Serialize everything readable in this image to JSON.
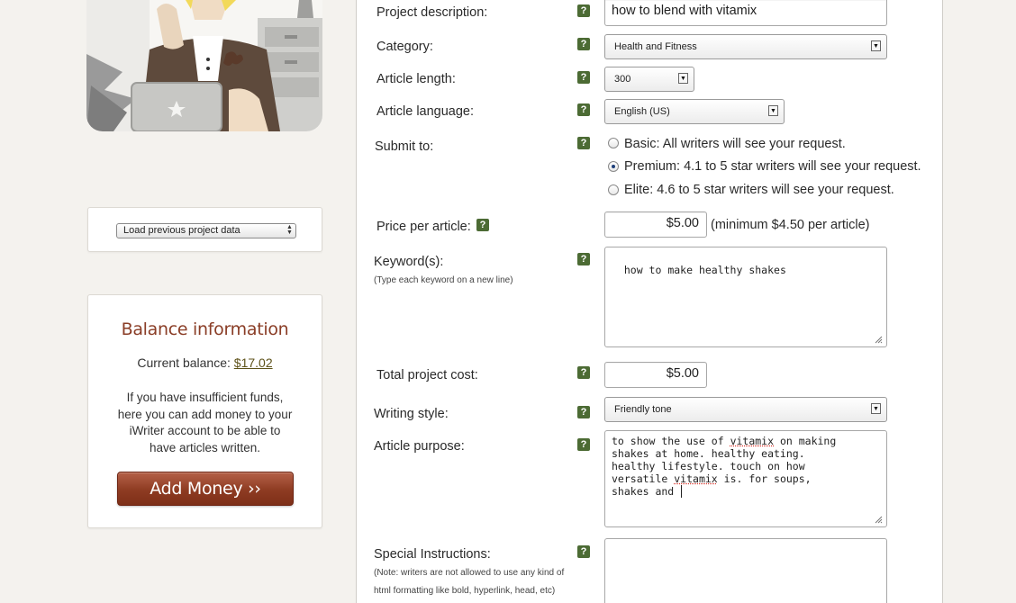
{
  "sidebar": {
    "load_select_value": "Load previous project data",
    "balance": {
      "title": "Balance information",
      "current_label": "Current balance: ",
      "current_value": "$17.02",
      "info": "If you have insufficient funds, here you can add money to your iWriter account to be able to have articles written.",
      "add_button": "Add Money ››"
    }
  },
  "form": {
    "help_glyph": "?",
    "project_description": {
      "label": "Project description:",
      "value": "how to blend with vitamix"
    },
    "category": {
      "label": "Category:",
      "value": "Health and Fitness"
    },
    "article_length": {
      "label": "Article length:",
      "value": "300"
    },
    "article_language": {
      "label": "Article language:",
      "value": "English (US)"
    },
    "submit_to": {
      "label": "Submit to:",
      "options": [
        {
          "label": "Basic: All writers will see your request.",
          "selected": false
        },
        {
          "label": "Premium: 4.1 to 5 star writers will see your request.",
          "selected": true
        },
        {
          "label": "Elite: 4.6 to 5 star writers will see your request.",
          "selected": false
        }
      ]
    },
    "price": {
      "label": "Price per article:",
      "value": "$5.00",
      "note": "(minimum $4.50 per article)"
    },
    "keywords": {
      "label": "Keyword(s):",
      "sublabel": "(Type each keyword on a new line)",
      "value": "how to make healthy shakes"
    },
    "total_cost": {
      "label": "Total project cost:",
      "value": "$5.00"
    },
    "writing_style": {
      "label": "Writing style:",
      "value": "Friendly tone"
    },
    "article_purpose": {
      "label": "Article purpose:",
      "lines": [
        {
          "a": "to show the use of ",
          "b": "vitamix",
          "c": " on making"
        },
        {
          "a": "shakes at home. healthy eating.",
          "b": "",
          "c": ""
        },
        {
          "a": "healthy lifestyle. touch on how",
          "b": "",
          "c": ""
        },
        {
          "a": "versatile ",
          "b": "vitamix",
          "c": " is. for soups,"
        },
        {
          "a": "shakes and ",
          "b": "",
          "c": ""
        }
      ]
    },
    "special_instructions": {
      "label": "Special Instructions:",
      "sublabel_1": "(Note: writers are not allowed to use any kind of",
      "sublabel_2": "html formatting like bold, hyperlink, head, etc)"
    }
  },
  "colors": {
    "help_icon": "#4c6b34",
    "balance_title": "#8a3d26",
    "add_money_button": "#8e3b22",
    "page_background": "#f4f2ee"
  }
}
